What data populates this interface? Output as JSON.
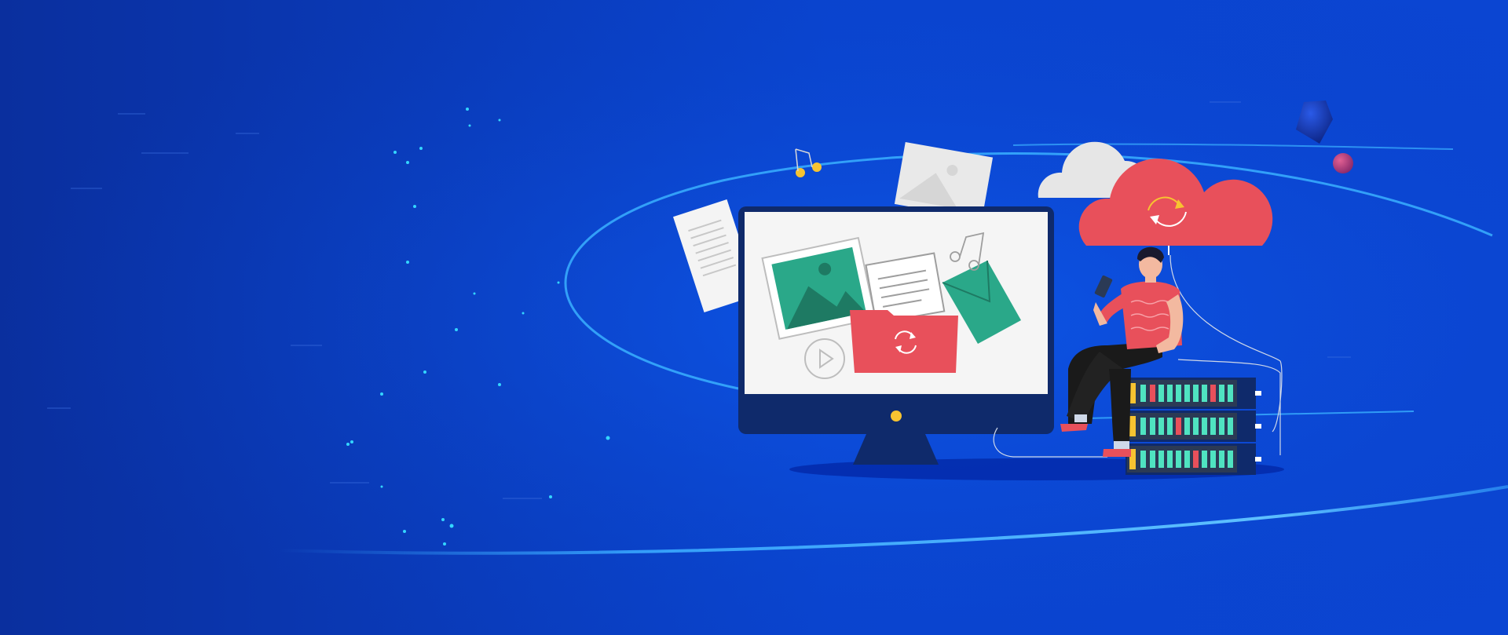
{
  "scene": {
    "description_free": true,
    "colors": {
      "background_top": "#0840c9",
      "background_bottom": "#0a3fc4",
      "background_dark_left": "#0a2f9e",
      "ring": "#39a9ff",
      "monitor_frame": "#0f2a6b",
      "screen": "#f5f5f5",
      "accent_red": "#e8505b",
      "accent_teal": "#2aa889",
      "accent_yellow": "#f7c331",
      "cloud_grey": "#e6e6e6",
      "server_body": "#2b3a55",
      "server_lights": "#4fe3c1"
    },
    "icons": [
      "monitor-icon",
      "cloud-sync-icon",
      "cloud-icon",
      "folder-sync-icon",
      "image-icon",
      "document-icon",
      "envelope-icon",
      "music-note-icon",
      "play-icon",
      "server-rack-icon",
      "person-with-phone-icon"
    ]
  }
}
